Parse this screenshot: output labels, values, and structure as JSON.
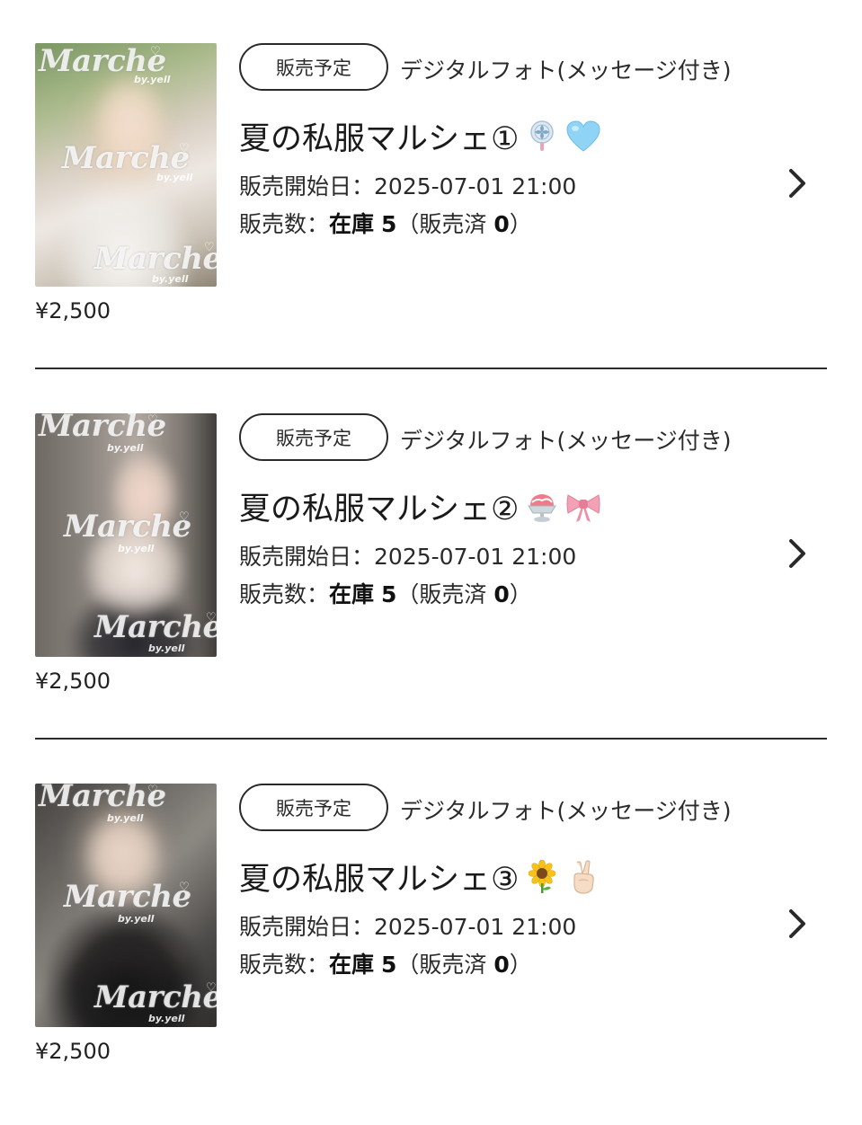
{
  "items": [
    {
      "badge": "販売予定",
      "category": "デジタルフォト(メッセージ付き)",
      "title": "夏の私服マルシェ①",
      "emojis": [
        "fan-icon",
        "blue-heart-icon"
      ],
      "sale_start_label": "販売開始日：",
      "sale_start_value": "2025-07-01 21:00",
      "sale_count_label": "販売数：",
      "stock_label": "在庫",
      "stock_value": "5",
      "sold_open": "（販売済 ",
      "sold_value": "0",
      "sold_close": "）",
      "price": "¥2,500",
      "watermark": "Marche",
      "watermark_sub": "by.yell"
    },
    {
      "badge": "販売予定",
      "category": "デジタルフォト(メッセージ付き)",
      "title": "夏の私服マルシェ②",
      "emojis": [
        "shaved-ice-icon",
        "ribbon-icon"
      ],
      "sale_start_label": "販売開始日：",
      "sale_start_value": "2025-07-01 21:00",
      "sale_count_label": "販売数：",
      "stock_label": "在庫",
      "stock_value": "5",
      "sold_open": "（販売済 ",
      "sold_value": "0",
      "sold_close": "）",
      "price": "¥2,500",
      "watermark": "Marche",
      "watermark_sub": "by.yell"
    },
    {
      "badge": "販売予定",
      "category": "デジタルフォト(メッセージ付き)",
      "title": "夏の私服マルシェ③",
      "emojis": [
        "sunflower-icon",
        "victory-hand-icon"
      ],
      "sale_start_label": "販売開始日：",
      "sale_start_value": "2025-07-01 21:00",
      "sale_count_label": "販売数：",
      "stock_label": "在庫",
      "stock_value": "5",
      "sold_open": "（販売済 ",
      "sold_value": "0",
      "sold_close": "）",
      "price": "¥2,500",
      "watermark": "Marche",
      "watermark_sub": "by.yell"
    }
  ],
  "colors": {
    "text": "#1a1a1a",
    "border": "#2a2a2a",
    "background": "#ffffff"
  }
}
